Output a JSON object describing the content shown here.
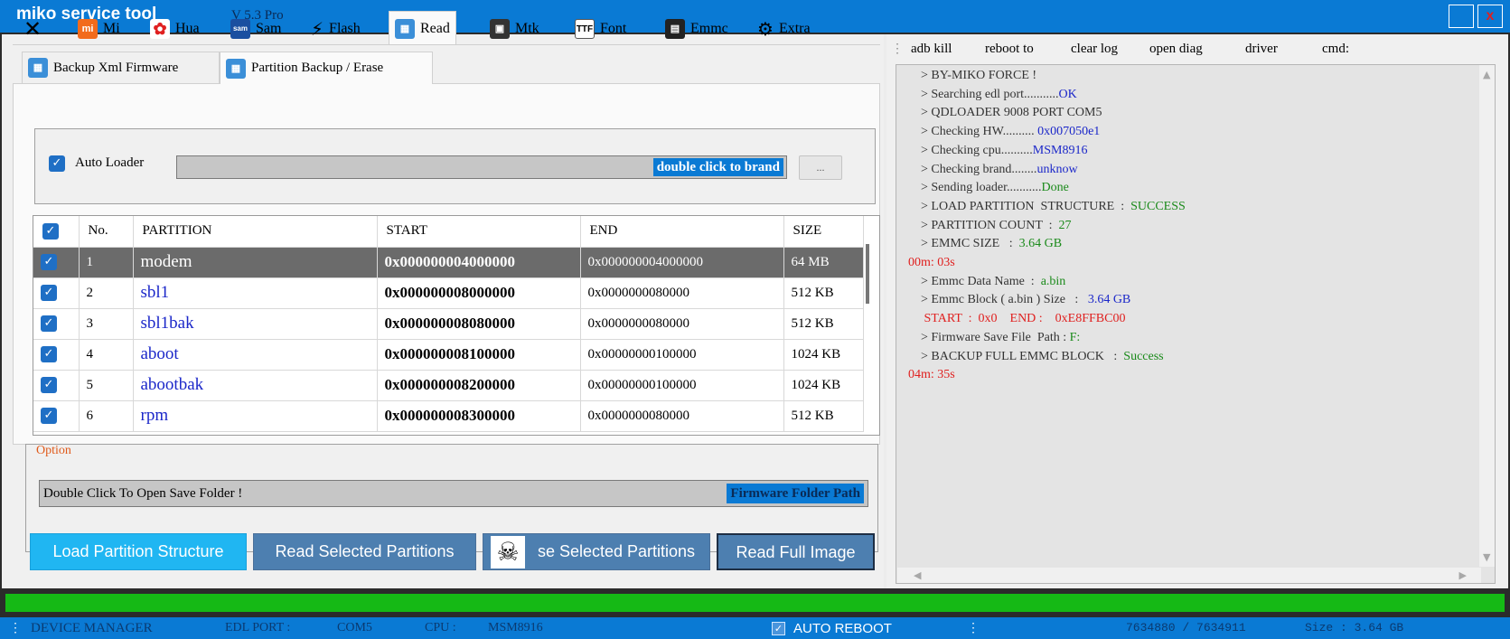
{
  "window": {
    "title": "miko service tool",
    "version": "V 5.3 Pro",
    "close_label": "x"
  },
  "main_tabs": [
    {
      "label": ""
    },
    {
      "label": "Mi"
    },
    {
      "label": "Hua"
    },
    {
      "label": "Sam"
    },
    {
      "label": "Flash"
    },
    {
      "label": "Read"
    },
    {
      "label": "Mtk"
    },
    {
      "label": "Font"
    },
    {
      "label": "Emmc"
    },
    {
      "label": "Extra"
    }
  ],
  "sub_tabs": [
    {
      "label": "Backup Xml Firmware"
    },
    {
      "label": "Partition Backup / Erase"
    }
  ],
  "loader": {
    "label": "Auto Loader",
    "brand_hint": "double click to brand",
    "browse_label": "..."
  },
  "table": {
    "headers": {
      "no": "No.",
      "partition": "PARTITION",
      "start": "START",
      "end": "END",
      "size": "SIZE"
    },
    "rows": [
      {
        "no": "1",
        "name": "modem",
        "start": "0x000000004000000",
        "end": "0x000000004000000",
        "size": "64 MB"
      },
      {
        "no": "2",
        "name": "sbl1",
        "start": "0x000000008000000",
        "end": "0x0000000080000",
        "size": "512 KB"
      },
      {
        "no": "3",
        "name": "sbl1bak",
        "start": "0x000000008080000",
        "end": "0x0000000080000",
        "size": "512 KB"
      },
      {
        "no": "4",
        "name": "aboot",
        "start": "0x000000008100000",
        "end": "0x00000000100000",
        "size": "1024 KB"
      },
      {
        "no": "5",
        "name": "abootbak",
        "start": "0x000000008200000",
        "end": "0x00000000100000",
        "size": "1024 KB"
      },
      {
        "no": "6",
        "name": "rpm",
        "start": "0x000000008300000",
        "end": "0x0000000080000",
        "size": "512 KB"
      }
    ]
  },
  "option": {
    "label": "Option",
    "folder_hint": "Double Click To Open Save Folder !",
    "folder_path_label": "Firmware Folder Path"
  },
  "actions": {
    "load": "Load Partition Structure",
    "read_selected": "Read Selected Partitions",
    "erase_selected": "se Selected Partitions",
    "read_full": "Read Full Image"
  },
  "toolbar": {
    "adb_kill": "adb kill",
    "reboot_to": "reboot to",
    "clear_log": "clear log",
    "open_diag": "open diag",
    "driver": "driver",
    "cmd": "cmd:"
  },
  "log": [
    [
      {
        "t": "> BY-MIKO FORCE !",
        "c": "grey"
      }
    ],
    [
      {
        "t": "> Searching edl port...........",
        "c": "grey"
      },
      {
        "t": "OK",
        "c": "blue"
      }
    ],
    [
      {
        "t": "> QDLOADER 9008 PORT COM5",
        "c": "grey"
      }
    ],
    [
      {
        "t": "> Checking HW.......... ",
        "c": "grey"
      },
      {
        "t": "0x007050e1",
        "c": "blue"
      }
    ],
    [
      {
        "t": "> Checking cpu..........",
        "c": "grey"
      },
      {
        "t": "MSM8916",
        "c": "blue"
      }
    ],
    [
      {
        "t": "> Checking brand........",
        "c": "grey"
      },
      {
        "t": "unknow",
        "c": "blue"
      }
    ],
    [
      {
        "t": "> Sending loader...........",
        "c": "grey"
      },
      {
        "t": "Done",
        "c": "green"
      }
    ],
    [
      {
        "t": "> LOAD PARTITION  STRUCTURE  :  ",
        "c": "grey"
      },
      {
        "t": "SUCCESS",
        "c": "green"
      }
    ],
    [
      {
        "t": "> PARTITION COUNT  :  ",
        "c": "grey"
      },
      {
        "t": "27",
        "c": "green"
      }
    ],
    [
      {
        "t": "> EMMC SIZE   :  ",
        "c": "grey"
      },
      {
        "t": "3.64 GB",
        "c": "green"
      }
    ],
    [
      {
        "t": "00m: 03s",
        "c": "red",
        "indent": false
      }
    ],
    [
      {
        "t": "> Emmc Data Name  :  ",
        "c": "grey"
      },
      {
        "t": "a.bin",
        "c": "green"
      }
    ],
    [
      {
        "t": "> Emmc Block ( a.bin ) Size   :   ",
        "c": "grey"
      },
      {
        "t": "3.64 GB",
        "c": "blue"
      }
    ],
    [
      {
        "t": " START  :  0x0    END :    0xE8FFBC00",
        "c": "red"
      }
    ],
    [
      {
        "t": "> Firmware Save File  Path : ",
        "c": "grey"
      },
      {
        "t": "F:",
        "c": "green"
      }
    ],
    [
      {
        "t": "> BACKUP FULL EMMC BLOCK   :  ",
        "c": "grey"
      },
      {
        "t": "Success",
        "c": "green"
      }
    ],
    [
      {
        "t": "04m: 35s",
        "c": "red",
        "indent": false
      }
    ]
  ],
  "status": {
    "device_manager": "DEVICE MANAGER",
    "edl_port_label": "EDL PORT :",
    "edl_port_value": "COM5",
    "cpu_label": "CPU :",
    "cpu_value": "MSM8916",
    "auto_reboot": "AUTO REBOOT",
    "progress_text": "7634880  /  7634911",
    "size_text": "Size : 3.64 GB"
  },
  "progress": {
    "fraction": 1.0
  },
  "colors": {
    "accent": "#0a7ad4",
    "progress": "#15b915",
    "selected_row": "#6b6b6b",
    "link_blue": "#1b27c9"
  }
}
